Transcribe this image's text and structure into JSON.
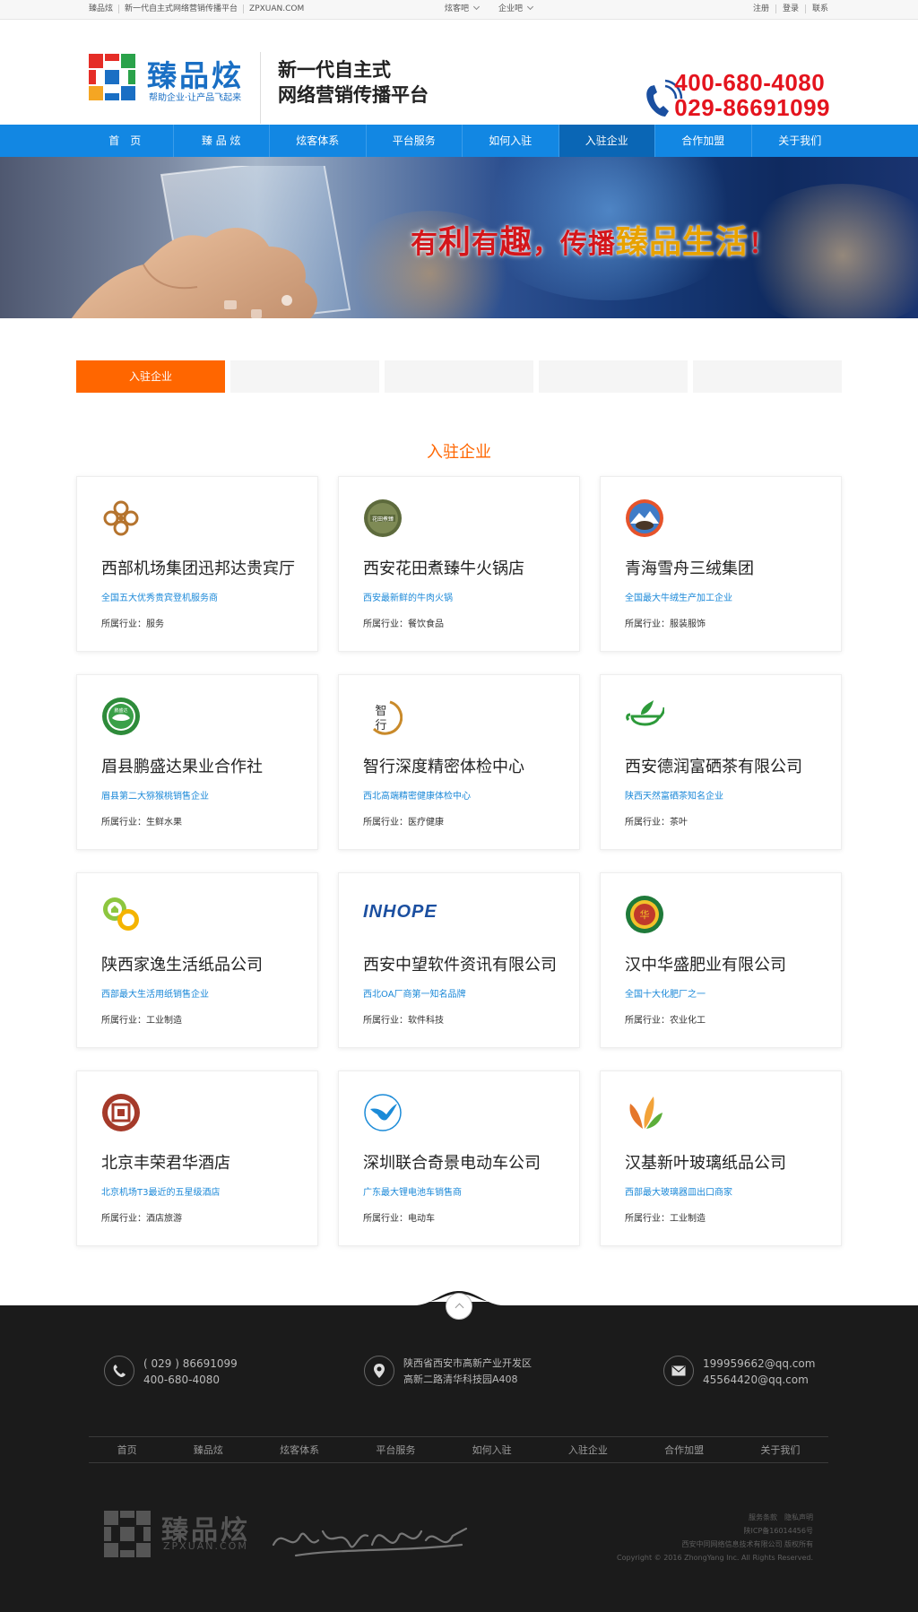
{
  "topbar": {
    "links": [
      "臻品炫",
      "新一代自主式网络营销传播平台",
      "ZPXUAN.COM"
    ],
    "dropdowns": [
      "炫客吧",
      "企业吧"
    ],
    "account": [
      "注册",
      "登录",
      "联系"
    ]
  },
  "header": {
    "logo_name": "臻品炫",
    "logo_sub": "帮助企业·让产品飞起来",
    "slogan_line1": "新一代自主式",
    "slogan_line2": "网络营销传播平台",
    "phone1": "400-680-4080",
    "phone2": "029-86691099"
  },
  "nav": {
    "items": [
      "首　页",
      "臻 品 炫",
      "炫客体系",
      "平台服务",
      "如何入驻",
      "入驻企业",
      "合作加盟",
      "关于我们"
    ],
    "active_index": 5
  },
  "banner": {
    "t1": "有",
    "t2": "利",
    "t3": "有",
    "t4": "趣",
    "t5": "，传播",
    "t6": "臻品生活",
    "t7": "！"
  },
  "tabs": {
    "items": [
      "入驻企业",
      "",
      "",
      "",
      ""
    ],
    "active_index": 0
  },
  "section_title": "入驻企业",
  "companies": [
    {
      "name": "西部机场集团迅邦达贵宾厅",
      "desc": "全国五大优秀贵宾登机服务商",
      "industry": "所属行业：服务",
      "logo": "swirl-logo"
    },
    {
      "name": "西安花田煮臻牛火锅店",
      "desc": "西安最新鲜的牛肉火锅",
      "industry": "所属行业：餐饮食品",
      "logo": "huatian-logo"
    },
    {
      "name": "青海雪舟三绒集团",
      "desc": "全国最大牛绒生产加工企业",
      "industry": "所属行业：服装服饰",
      "logo": "yak-logo"
    },
    {
      "name": "眉县鹏盛达果业合作社",
      "desc": "眉县第二大猕猴桃销售企业",
      "industry": "所属行业：生鲜水果",
      "logo": "pengshengda-logo"
    },
    {
      "name": "智行深度精密体检中心",
      "desc": "西北高端精密健康体检中心",
      "industry": "所属行业：医疗健康",
      "logo": "zhixing-logo"
    },
    {
      "name": "西安德润富硒茶有限公司",
      "desc": "陕西天然富硒茶知名企业",
      "industry": "所属行业：茶叶",
      "logo": "teapot-logo"
    },
    {
      "name": "陕西家逸生活纸品公司",
      "desc": "西部最大生活用纸销售企业",
      "industry": "所属行业：工业制造",
      "logo": "jiayi-logo"
    },
    {
      "name": "西安中望软件资讯有限公司",
      "desc": "西北OA厂商第一知名品牌",
      "industry": "所属行业：软件科技",
      "logo": "inhope-logo"
    },
    {
      "name": "汉中华盛肥业有限公司",
      "desc": "全国十大化肥厂之一",
      "industry": "所属行业：农业化工",
      "logo": "huasheng-logo"
    },
    {
      "name": "北京丰荣君华酒店",
      "desc": "北京机场T3最近的五星级酒店",
      "industry": "所属行业：酒店旅游",
      "logo": "hotel-logo"
    },
    {
      "name": "深圳联合奇景电动车公司",
      "desc": "广东最大锂电池车销售商",
      "industry": "所属行业：电动车",
      "logo": "bird-logo"
    },
    {
      "name": "汉基新叶玻璃纸品公司",
      "desc": "西部最大玻璃器皿出口商家",
      "industry": "所属行业：工业制造",
      "logo": "leaf-logo"
    }
  ],
  "inhope_text": "INHOPE",
  "footer": {
    "phone1": "( 029 ) 86691099",
    "phone2": "400-680-4080",
    "address1": "陕西省西安市高新产业开发区",
    "address2": "高新二路清华科技园A408",
    "email1": "199959662@qq.com",
    "email2": "45564420@qq.com",
    "nav": [
      "首页",
      "臻品炫",
      "炫客体系",
      "平台服务",
      "如何入驻",
      "入驻企业",
      "合作加盟",
      "关于我们"
    ],
    "logo_name": "臻品炫",
    "logo_domain": "ZPXUAN.COM",
    "copy_links": "服务条款　隐私声明",
    "icp": "陕ICP备16014456号",
    "company": "西安中同网络信息技术有限公司 版权所有",
    "copyright": "Copyright © 2016 ZhongYang Inc. All Rights Reserved."
  },
  "colors": {
    "nav_blue": "#1287e3",
    "accent_orange": "#ff6600",
    "phone_red": "#e4141e",
    "link_blue": "#1a88d8",
    "footer_bg": "#1b1b1b"
  }
}
